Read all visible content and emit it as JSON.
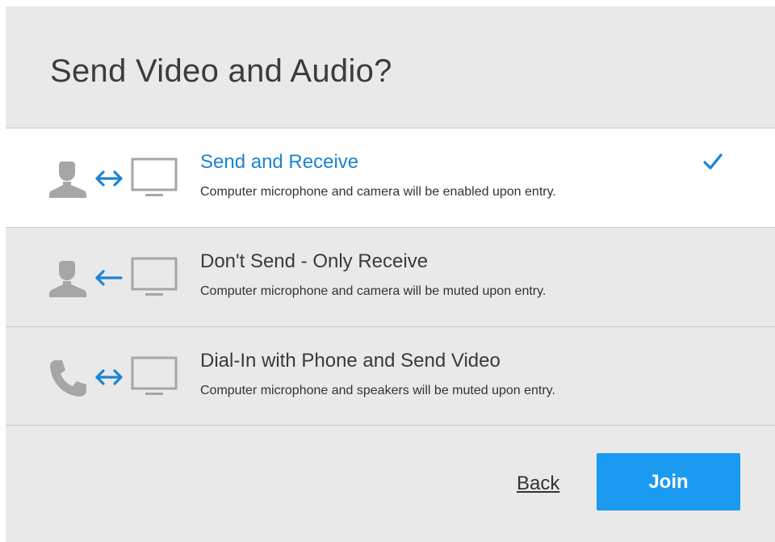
{
  "dialog": {
    "title": "Send Video and Audio?"
  },
  "options": [
    {
      "title": "Send and Receive",
      "description": "Computer microphone and camera will be enabled upon entry.",
      "selected": true,
      "left_icon": "person-icon",
      "arrow_icon": "bidirectional-arrow-icon",
      "right_icon": "monitor-icon"
    },
    {
      "title": "Don't Send - Only Receive",
      "description": "Computer microphone and camera will be muted upon entry.",
      "selected": false,
      "left_icon": "person-icon",
      "arrow_icon": "left-arrow-icon",
      "right_icon": "monitor-icon"
    },
    {
      "title": "Dial-In with Phone and Send Video",
      "description": "Computer microphone and speakers will be muted upon entry.",
      "selected": false,
      "left_icon": "phone-icon",
      "arrow_icon": "bidirectional-arrow-icon",
      "right_icon": "monitor-icon"
    }
  ],
  "footer": {
    "back_label": "Back",
    "join_label": "Join"
  },
  "colors": {
    "accent": "#1a84d3",
    "button": "#1a9af0",
    "icon_gray": "#a6a6a6",
    "panel_bg": "#e9e9e9",
    "selected_bg": "#ffffff"
  }
}
